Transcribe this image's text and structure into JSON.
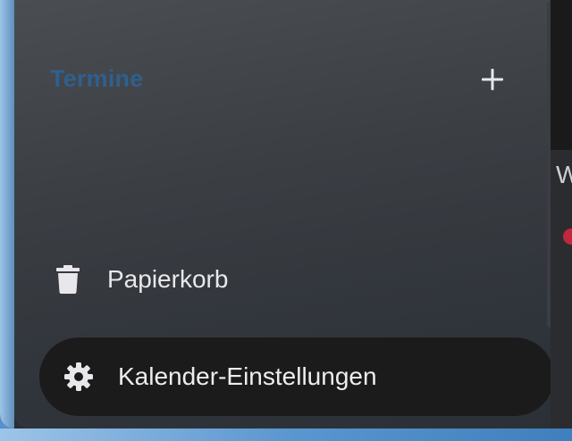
{
  "sidebar": {
    "section_title": "Termine",
    "add_icon": "plus-icon",
    "trash": {
      "icon": "trash-icon",
      "label": "Papierkorb"
    },
    "settings": {
      "icon": "gear-icon",
      "label": "Kalender-Einstellungen"
    }
  },
  "main": {
    "partial_heading": "W"
  },
  "colors": {
    "section_title": "#2f5f8e",
    "sidebar_bg": "#3b3e43",
    "settings_bg": "#1b1b1c",
    "event_dot": "#c0283d"
  }
}
